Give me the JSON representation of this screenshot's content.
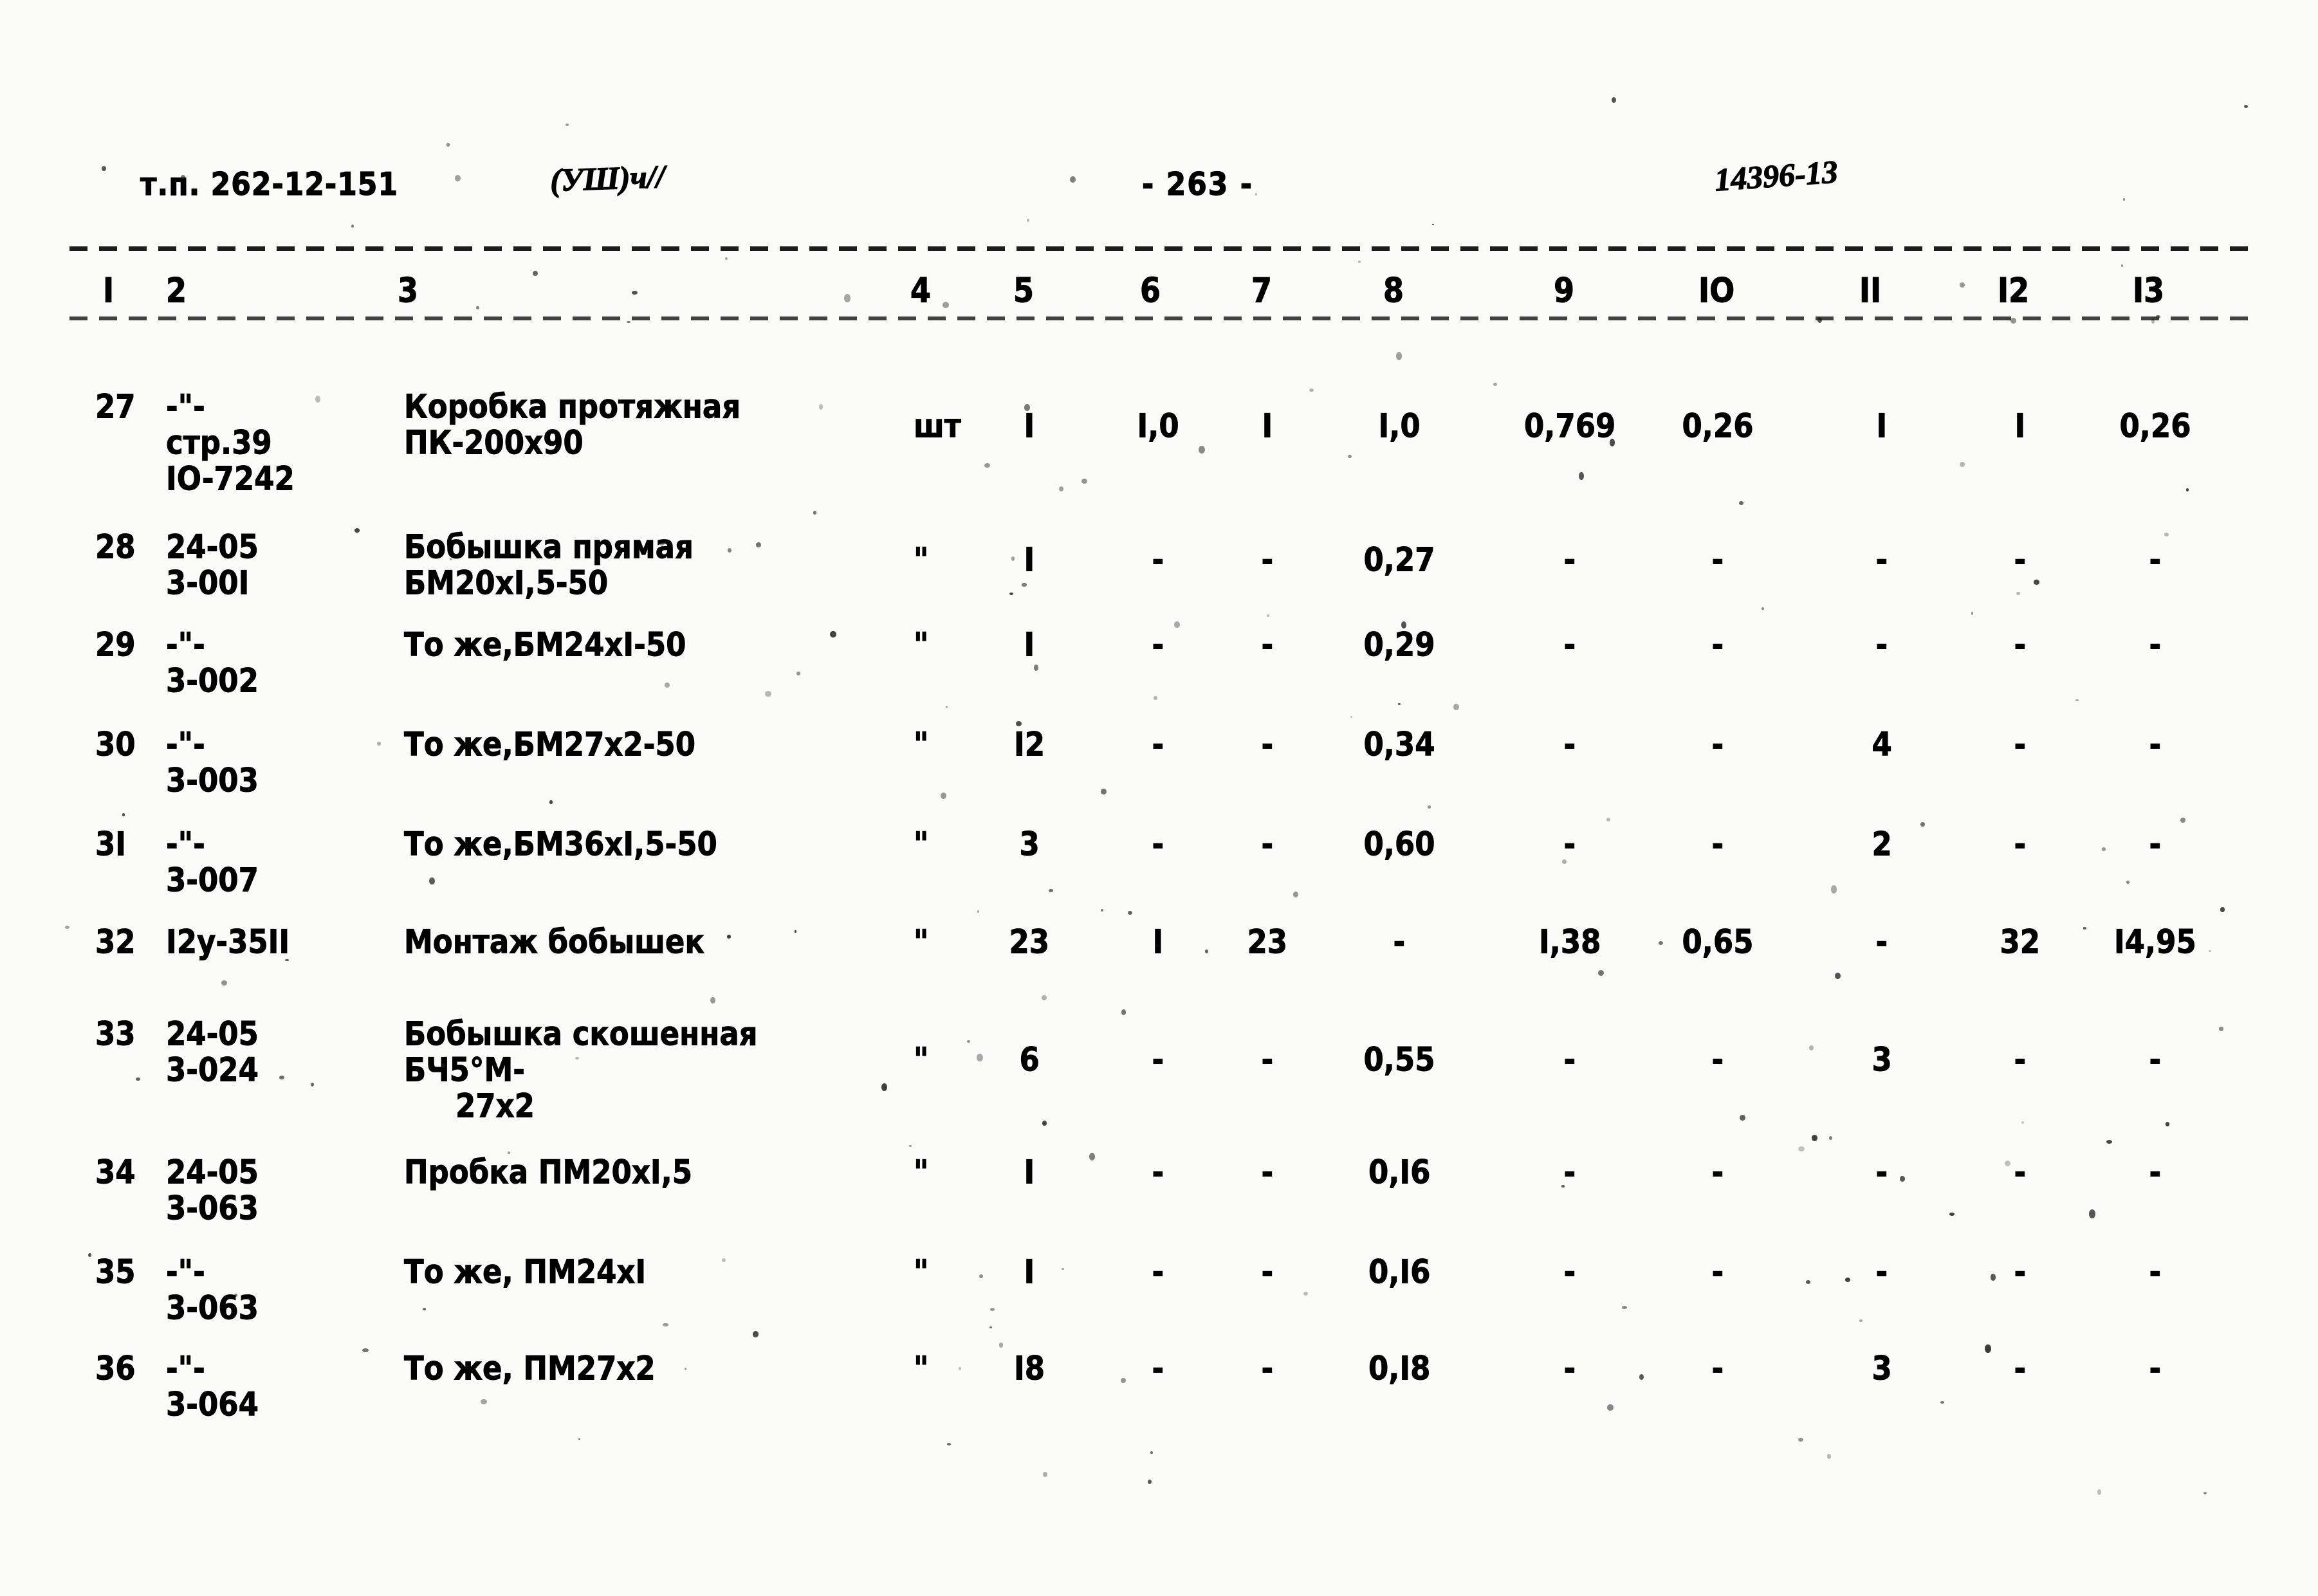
{
  "header": {
    "doc_code": "т.п. 262-12-151",
    "section_handwritten": "(УШ)ч//",
    "page_number": "- 263 -",
    "right_handwritten": "14396-13"
  },
  "table": {
    "column_numbers": [
      "I",
      "2",
      "3",
      "4",
      "5",
      "6",
      "7",
      "8",
      "9",
      "IO",
      "II",
      "I2",
      "I3"
    ],
    "rows": [
      {
        "n": "27",
        "code1": "-\"-",
        "code2": "стр.39",
        "code3": "IO-7242",
        "name1": "Коробка протяжная",
        "name2": "ПК-200х90",
        "unit": "шт",
        "c5": "I",
        "c6": "I,0",
        "c7": "I",
        "c8": "I,0",
        "c9": "0,769",
        "c10": "0,26",
        "c11": "I",
        "c12": "I",
        "c13": "0,26"
      },
      {
        "n": "28",
        "code1": "24-05",
        "code2": "3-00I",
        "code3": "",
        "name1": "Бобышка прямая",
        "name2": "БМ20хI,5-50",
        "unit": "\"",
        "c5": "I",
        "c6": "-",
        "c7": "-",
        "c8": "0,27",
        "c9": "-",
        "c10": "-",
        "c11": "-",
        "c12": "-",
        "c13": "-"
      },
      {
        "n": "29",
        "code1": "-\"-",
        "code2": "3-002",
        "code3": "",
        "name1": "То же,БМ24хI-50",
        "name2": "",
        "unit": "\"",
        "c5": "I",
        "c6": "-",
        "c7": "-",
        "c8": "0,29",
        "c9": "-",
        "c10": "-",
        "c11": "-",
        "c12": "-",
        "c13": "-"
      },
      {
        "n": "30",
        "code1": "-\"-",
        "code2": "3-003",
        "code3": "",
        "name1": "То же,БМ27х2-50",
        "name2": "",
        "unit": "\"",
        "c5": "I2",
        "c6": "-",
        "c7": "-",
        "c8": "0,34",
        "c9": "-",
        "c10": "-",
        "c11": "4",
        "c12": "-",
        "c13": "-"
      },
      {
        "n": "3I",
        "code1": "-\"-",
        "code2": "3-007",
        "code3": "",
        "name1": "То же,БМ36хI,5-50",
        "name2": "",
        "unit": "\"",
        "c5": "3",
        "c6": "-",
        "c7": "-",
        "c8": "0,60",
        "c9": "-",
        "c10": "-",
        "c11": "2",
        "c12": "-",
        "c13": "-"
      },
      {
        "n": "32",
        "code1": "I2у-35II",
        "code2": "",
        "code3": "",
        "name1": "Монтаж бобышек",
        "name2": "",
        "unit": "\"",
        "c5": "23",
        "c6": "I",
        "c7": "23",
        "c8": "-",
        "c9": "I,38",
        "c10": "0,65",
        "c11": "-",
        "c12": "32",
        "c13": "I4,95"
      },
      {
        "n": "33",
        "code1": "24-05",
        "code2": "3-024",
        "code3": "",
        "name1": "Бобышка скошенная",
        "name2": "БЧ5°М-",
        "name3": "27х2",
        "unit": "\"",
        "c5": "6",
        "c6": "-",
        "c7": "-",
        "c8": "0,55",
        "c9": "-",
        "c10": "-",
        "c11": "3",
        "c12": "-",
        "c13": "-"
      },
      {
        "n": "34",
        "code1": "24-05",
        "code2": "3-063",
        "code3": "",
        "name1": "Пробка ПМ20хI,5",
        "name2": "",
        "unit": "\"",
        "c5": "I",
        "c6": "-",
        "c7": "-",
        "c8": "0,I6",
        "c9": "-",
        "c10": "-",
        "c11": "-",
        "c12": "-",
        "c13": "-"
      },
      {
        "n": "35",
        "code1": "-\"-",
        "code2": "3-063",
        "code3": "",
        "name1": "То же, ПМ24хI",
        "name2": "",
        "unit": "\"",
        "c5": "I",
        "c6": "-",
        "c7": "-",
        "c8": "0,I6",
        "c9": "-",
        "c10": "-",
        "c11": "-",
        "c12": "-",
        "c13": "-"
      },
      {
        "n": "36",
        "code1": "-\"-",
        "code2": "3-064",
        "code3": "",
        "name1": "То же, ПМ27х2",
        "name2": "",
        "unit": "\"",
        "c5": "I8",
        "c6": "-",
        "c7": "-",
        "c8": "0,I8",
        "c9": "-",
        "c10": "-",
        "c11": "3",
        "c12": "-",
        "c13": "-"
      }
    ]
  }
}
